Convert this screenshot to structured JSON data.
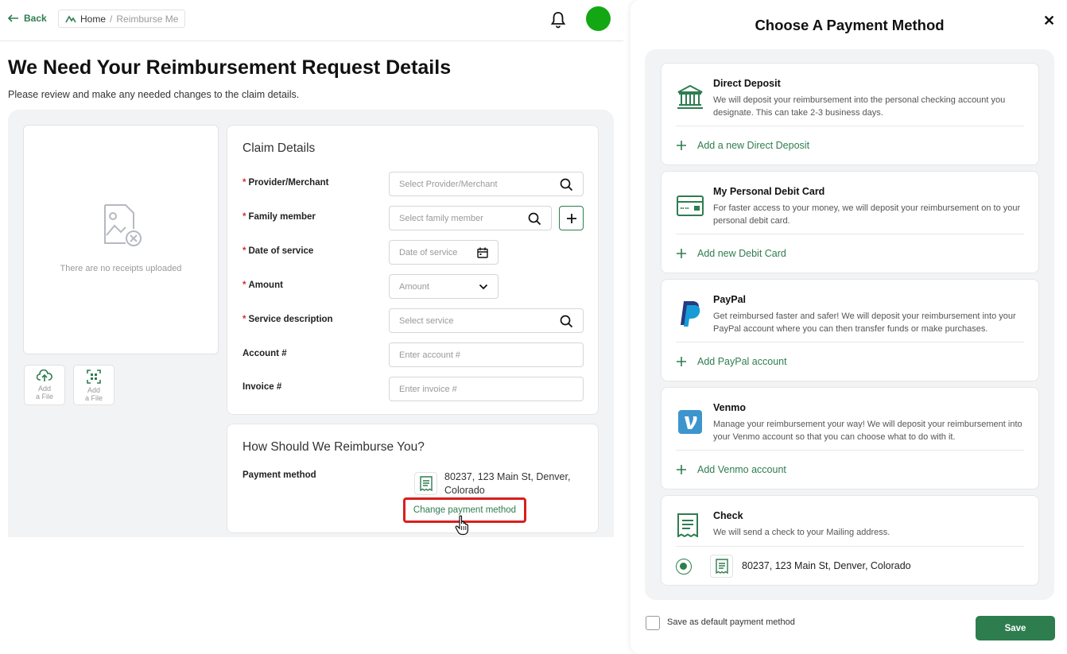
{
  "topbar": {
    "back_label": "Back",
    "breadcrumb_home": "Home",
    "breadcrumb_sep": "/",
    "breadcrumb_current": "Reimburse Me"
  },
  "page": {
    "title": "We Need Your Reimbursement Request Details",
    "subtitle": "Please review and make any needed changes to the claim details."
  },
  "receipts": {
    "empty_text": "There are no receipts uploaded",
    "add_file_1": "Add\na File",
    "add_file_2": "Add\na File"
  },
  "claim": {
    "title": "Claim Details",
    "provider_label": "Provider/Merchant",
    "provider_placeholder": "Select Provider/Merchant",
    "family_label": "Family member",
    "family_placeholder": "Select family member",
    "date_label": "Date of service",
    "date_placeholder": "Date of service",
    "amount_label": "Amount",
    "amount_placeholder": "Amount",
    "service_label": "Service description",
    "service_placeholder": "Select service",
    "account_label": "Account #",
    "account_placeholder": "Enter account #",
    "invoice_label": "Invoice #",
    "invoice_placeholder": "Enter invoice #",
    "required_mark": "*"
  },
  "reimburse": {
    "title": "How Should We Reimburse You?",
    "payment_label": "Payment method",
    "address": "80237, 123 Main St, Denver, Colorado",
    "change_link": "Change payment method"
  },
  "panel": {
    "title": "Choose A Payment Method",
    "close": "✕",
    "methods": [
      {
        "name": "Direct Deposit",
        "desc": "We will deposit your reimbursement into the personal checking account you designate. This can take 2-3 business days.",
        "add": "Add a new Direct Deposit"
      },
      {
        "name": "My Personal Debit Card",
        "desc": "For faster access to your money, we will deposit your reimbursement on to your personal debit card.",
        "add": "Add new Debit Card"
      },
      {
        "name": "PayPal",
        "desc": "Get reimbursed faster and safer! We will deposit your reimbursement into your PayPal account where you can then transfer funds or make purchases.",
        "add": "Add PayPal account"
      },
      {
        "name": "Venmo",
        "desc": "Manage your reimbursement your way! We will deposit your reimbursement into your Venmo account so that you can choose what to do with it.",
        "add": "Add Venmo account"
      },
      {
        "name": "Check",
        "desc": "We will send a check to your Mailing address.",
        "address": "80237, 123 Main St, Denver, Colorado"
      }
    ],
    "default_label": "Save as default payment method",
    "save_label": "Save"
  },
  "colors": {
    "brand_green": "#2e7d4f",
    "avatar_green": "#13a813",
    "highlight_red": "#d81e1e",
    "required_red": "#d0312d"
  }
}
